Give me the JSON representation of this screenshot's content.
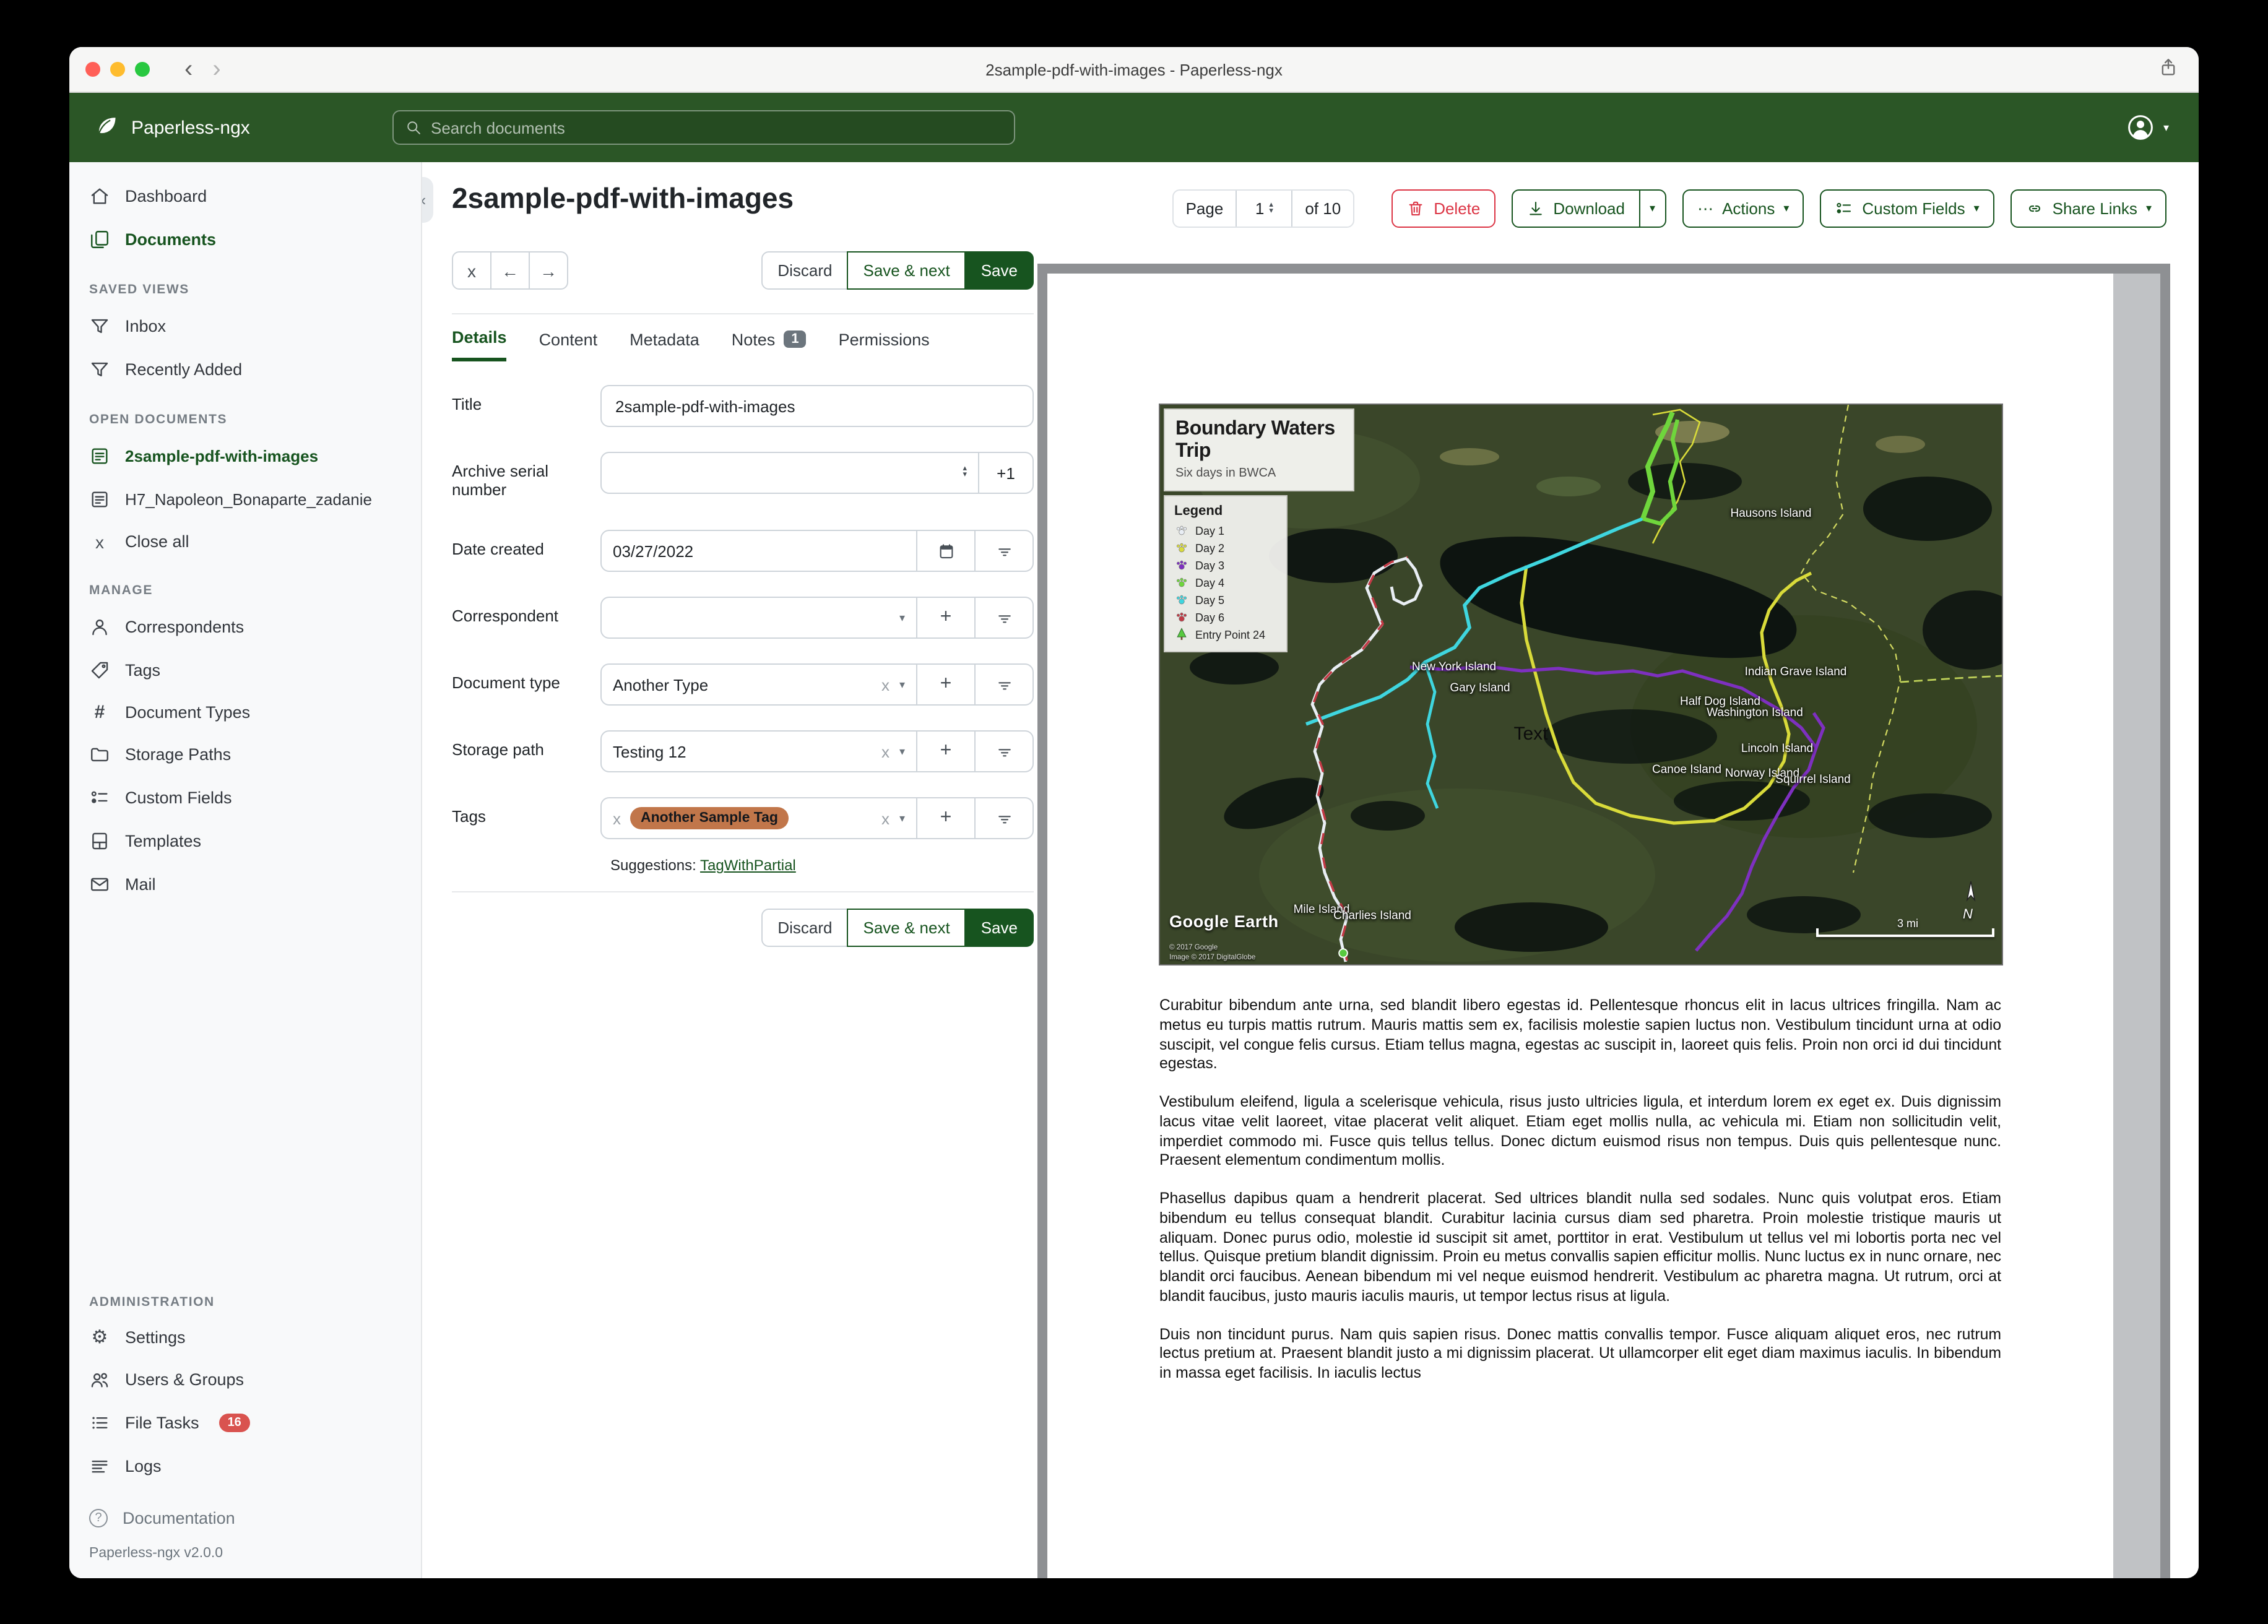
{
  "colors": {
    "header": "#2b5626",
    "accent": "#17541f",
    "danger": "#dc3545",
    "tag_chip": "#c1764a",
    "badge_gray": "#6c757d",
    "badge_red": "#d9534f"
  },
  "glyphs": {
    "back": "‹",
    "forward": "›",
    "collapse": "«",
    "close": "×",
    "close_small": "x",
    "arrow_left": "←",
    "arrow_right": "→",
    "caret": "▾",
    "ellipsis": "⋯",
    "plus": "+",
    "hash": "#",
    "gear": "⚙",
    "question": "?",
    "spin_up": "▴",
    "spin_down": "▾",
    "compass_n": "N"
  },
  "window": {
    "title": "2sample-pdf-with-images - Paperless-ngx"
  },
  "header": {
    "brand": "Paperless-ngx",
    "search_placeholder": "Search documents"
  },
  "sidebar": {
    "dashboard": "Dashboard",
    "documents": "Documents",
    "saved_views": {
      "heading": "SAVED VIEWS",
      "items": [
        "Inbox",
        "Recently Added"
      ]
    },
    "open_docs": {
      "heading": "OPEN DOCUMENTS",
      "items": [
        "2sample-pdf-with-images",
        "H7_Napoleon_Bonaparte_zadanie"
      ],
      "close_all": "Close all"
    },
    "manage": {
      "heading": "MANAGE",
      "items": [
        "Correspondents",
        "Tags",
        "Document Types",
        "Storage Paths",
        "Custom Fields",
        "Templates",
        "Mail"
      ]
    },
    "admin": {
      "heading": "ADMINISTRATION",
      "items": [
        "Settings",
        "Users & Groups",
        "File Tasks",
        "Logs"
      ],
      "file_tasks_badge": "16"
    },
    "footer": {
      "documentation": "Documentation",
      "version": "Paperless-ngx v2.0.0"
    }
  },
  "toolbar": {
    "page_label": "Page",
    "page_value": "1",
    "page_of": "of 10",
    "delete": "Delete",
    "download": "Download",
    "actions": "Actions",
    "custom_fields": "Custom Fields",
    "share_links": "Share Links"
  },
  "doc": {
    "title": "2sample-pdf-with-images",
    "nav": {
      "discard": "Discard",
      "save_next": "Save & next",
      "save": "Save"
    },
    "tabs": [
      "Details",
      "Content",
      "Metadata",
      "Notes",
      "Permissions"
    ],
    "notes_badge": "1",
    "fields": {
      "title_label": "Title",
      "title_value": "2sample-pdf-with-images",
      "asn_label": "Archive serial number",
      "asn_plus": "+1",
      "date_label": "Date created",
      "date_value": "03/27/2022",
      "correspondent_label": "Correspondent",
      "doctype_label": "Document type",
      "doctype_value": "Another Type",
      "storage_label": "Storage path",
      "storage_value": "Testing 12",
      "tags_label": "Tags",
      "tag_chip": "Another Sample Tag",
      "suggestions_label": "Suggestions:",
      "suggestion_link": "TagWithPartial"
    }
  },
  "preview": {
    "map": {
      "title": "Boundary Waters Trip",
      "subtitle": "Six days in BWCA",
      "legend_title": "Legend",
      "legend": [
        {
          "label": "Day 1",
          "color": "#e9eef4"
        },
        {
          "label": "Day 2",
          "color": "#d9db3a"
        },
        {
          "label": "Day 3",
          "color": "#7e30c0"
        },
        {
          "label": "Day 4",
          "color": "#6fd63c"
        },
        {
          "label": "Day 5",
          "color": "#3fd6df"
        },
        {
          "label": "Day 6",
          "color": "#c23a45"
        },
        {
          "label": "Entry Point 24",
          "color": "#58c93f"
        }
      ],
      "labels": [
        "Hausons Island",
        "New York Island",
        "Gary Island",
        "Indian Grave Island",
        "Half Dog Island",
        "Washington Island",
        "Lincoln Island",
        "Canoe Island",
        "Norway Island",
        "Squirrel Island",
        "Mile Island",
        "Charlies Island"
      ],
      "text_note": "Text",
      "credits": {
        "logo": "Google Earth",
        "line1": "© 2017 Google",
        "line2": "Image © 2017 DigitalGlobe"
      },
      "scale_text": "3 mi"
    },
    "paragraphs": [
      "Curabitur bibendum ante urna, sed blandit libero egestas id. Pellentesque rhoncus elit in lacus ultrices fringilla. Nam ac metus eu turpis mattis rutrum. Mauris mattis sem ex, facilisis molestie sapien luctus non. Vestibulum tincidunt urna at odio suscipit, vel congue felis cursus. Etiam tellus magna, egestas ac suscipit in, laoreet quis felis. Proin non orci id dui tincidunt egestas.",
      "Vestibulum eleifend, ligula a scelerisque vehicula, risus justo ultricies ligula, et interdum lorem ex eget ex. Duis dignissim lacus vitae velit laoreet, vitae placerat velit aliquet. Etiam eget mollis nulla, ac vehicula mi. Etiam non sollicitudin velit, imperdiet commodo mi. Fusce quis tellus tellus. Donec dictum euismod risus non tempus. Duis quis pellentesque nunc. Praesent elementum condimentum mollis.",
      "Phasellus dapibus quam a hendrerit placerat. Sed ultrices blandit nulla sed sodales. Nunc quis volutpat eros. Etiam bibendum eu tellus consequat blandit. Curabitur lacinia cursus diam sed pharetra. Proin molestie tristique mauris ut aliquam. Donec purus odio, molestie id suscipit sit amet, porttitor in erat. Vestibulum ut tellus vel mi lobortis porta nec vel tellus. Quisque pretium blandit dignissim. Proin eu metus convallis sapien efficitur mollis. Nunc luctus ex in nunc ornare, nec blandit orci faucibus. Aenean bibendum mi vel neque euismod hendrerit. Vestibulum ac pharetra magna. Ut rutrum, orci at blandit faucibus, justo mauris iaculis mauris, ut tempor lectus risus at ligula.",
      "Duis non tincidunt purus. Nam quis sapien risus. Donec mattis convallis tempor. Fusce aliquam aliquet eros, nec rutrum lectus pretium at. Praesent blandit justo a mi dignissim placerat. Ut ullamcorper elit eget diam maximus iaculis. In bibendum in massa eget facilisis. In iaculis lectus"
    ]
  }
}
